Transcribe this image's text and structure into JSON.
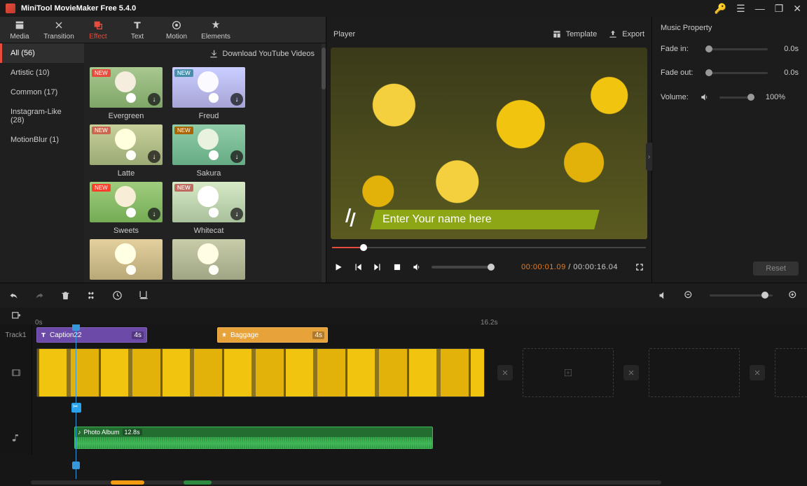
{
  "app": {
    "title": "MiniTool MovieMaker Free 5.4.0"
  },
  "toolbar": {
    "media": "Media",
    "transition": "Transition",
    "effect": "Effect",
    "text": "Text",
    "motion": "Motion",
    "elements": "Elements"
  },
  "categories": {
    "all": "All (56)",
    "artistic": "Artistic (10)",
    "common": "Common (17)",
    "instagram": "Instagram-Like (28)",
    "motionblur": "MotionBlur (1)"
  },
  "download_label": "Download YouTube Videos",
  "effects": {
    "evergreen": "Evergreen",
    "freud": "Freud",
    "latte": "Latte",
    "sakura": "Sakura",
    "sweets": "Sweets",
    "whitecat": "Whitecat"
  },
  "new_badge": "NEW",
  "player": {
    "title": "Player",
    "template": "Template",
    "export": "Export",
    "overlay_text": "Enter Your name here",
    "time_current": "00:00:01.09",
    "time_sep": " / ",
    "time_total": "00:00:16.04"
  },
  "props": {
    "title": "Music Property",
    "fade_in": "Fade in:",
    "fade_in_val": "0.0s",
    "fade_out": "Fade out:",
    "fade_out_val": "0.0s",
    "volume": "Volume:",
    "volume_val": "100%",
    "reset": "Reset"
  },
  "timeline": {
    "zero": "0s",
    "mid": "16.2s",
    "track1": "Track1",
    "caption_name": "Caption22",
    "caption_dur": "4s",
    "element_name": "Baggage",
    "element_dur": "4s",
    "audio_name": "Photo Album",
    "audio_dur": "12.8s"
  }
}
